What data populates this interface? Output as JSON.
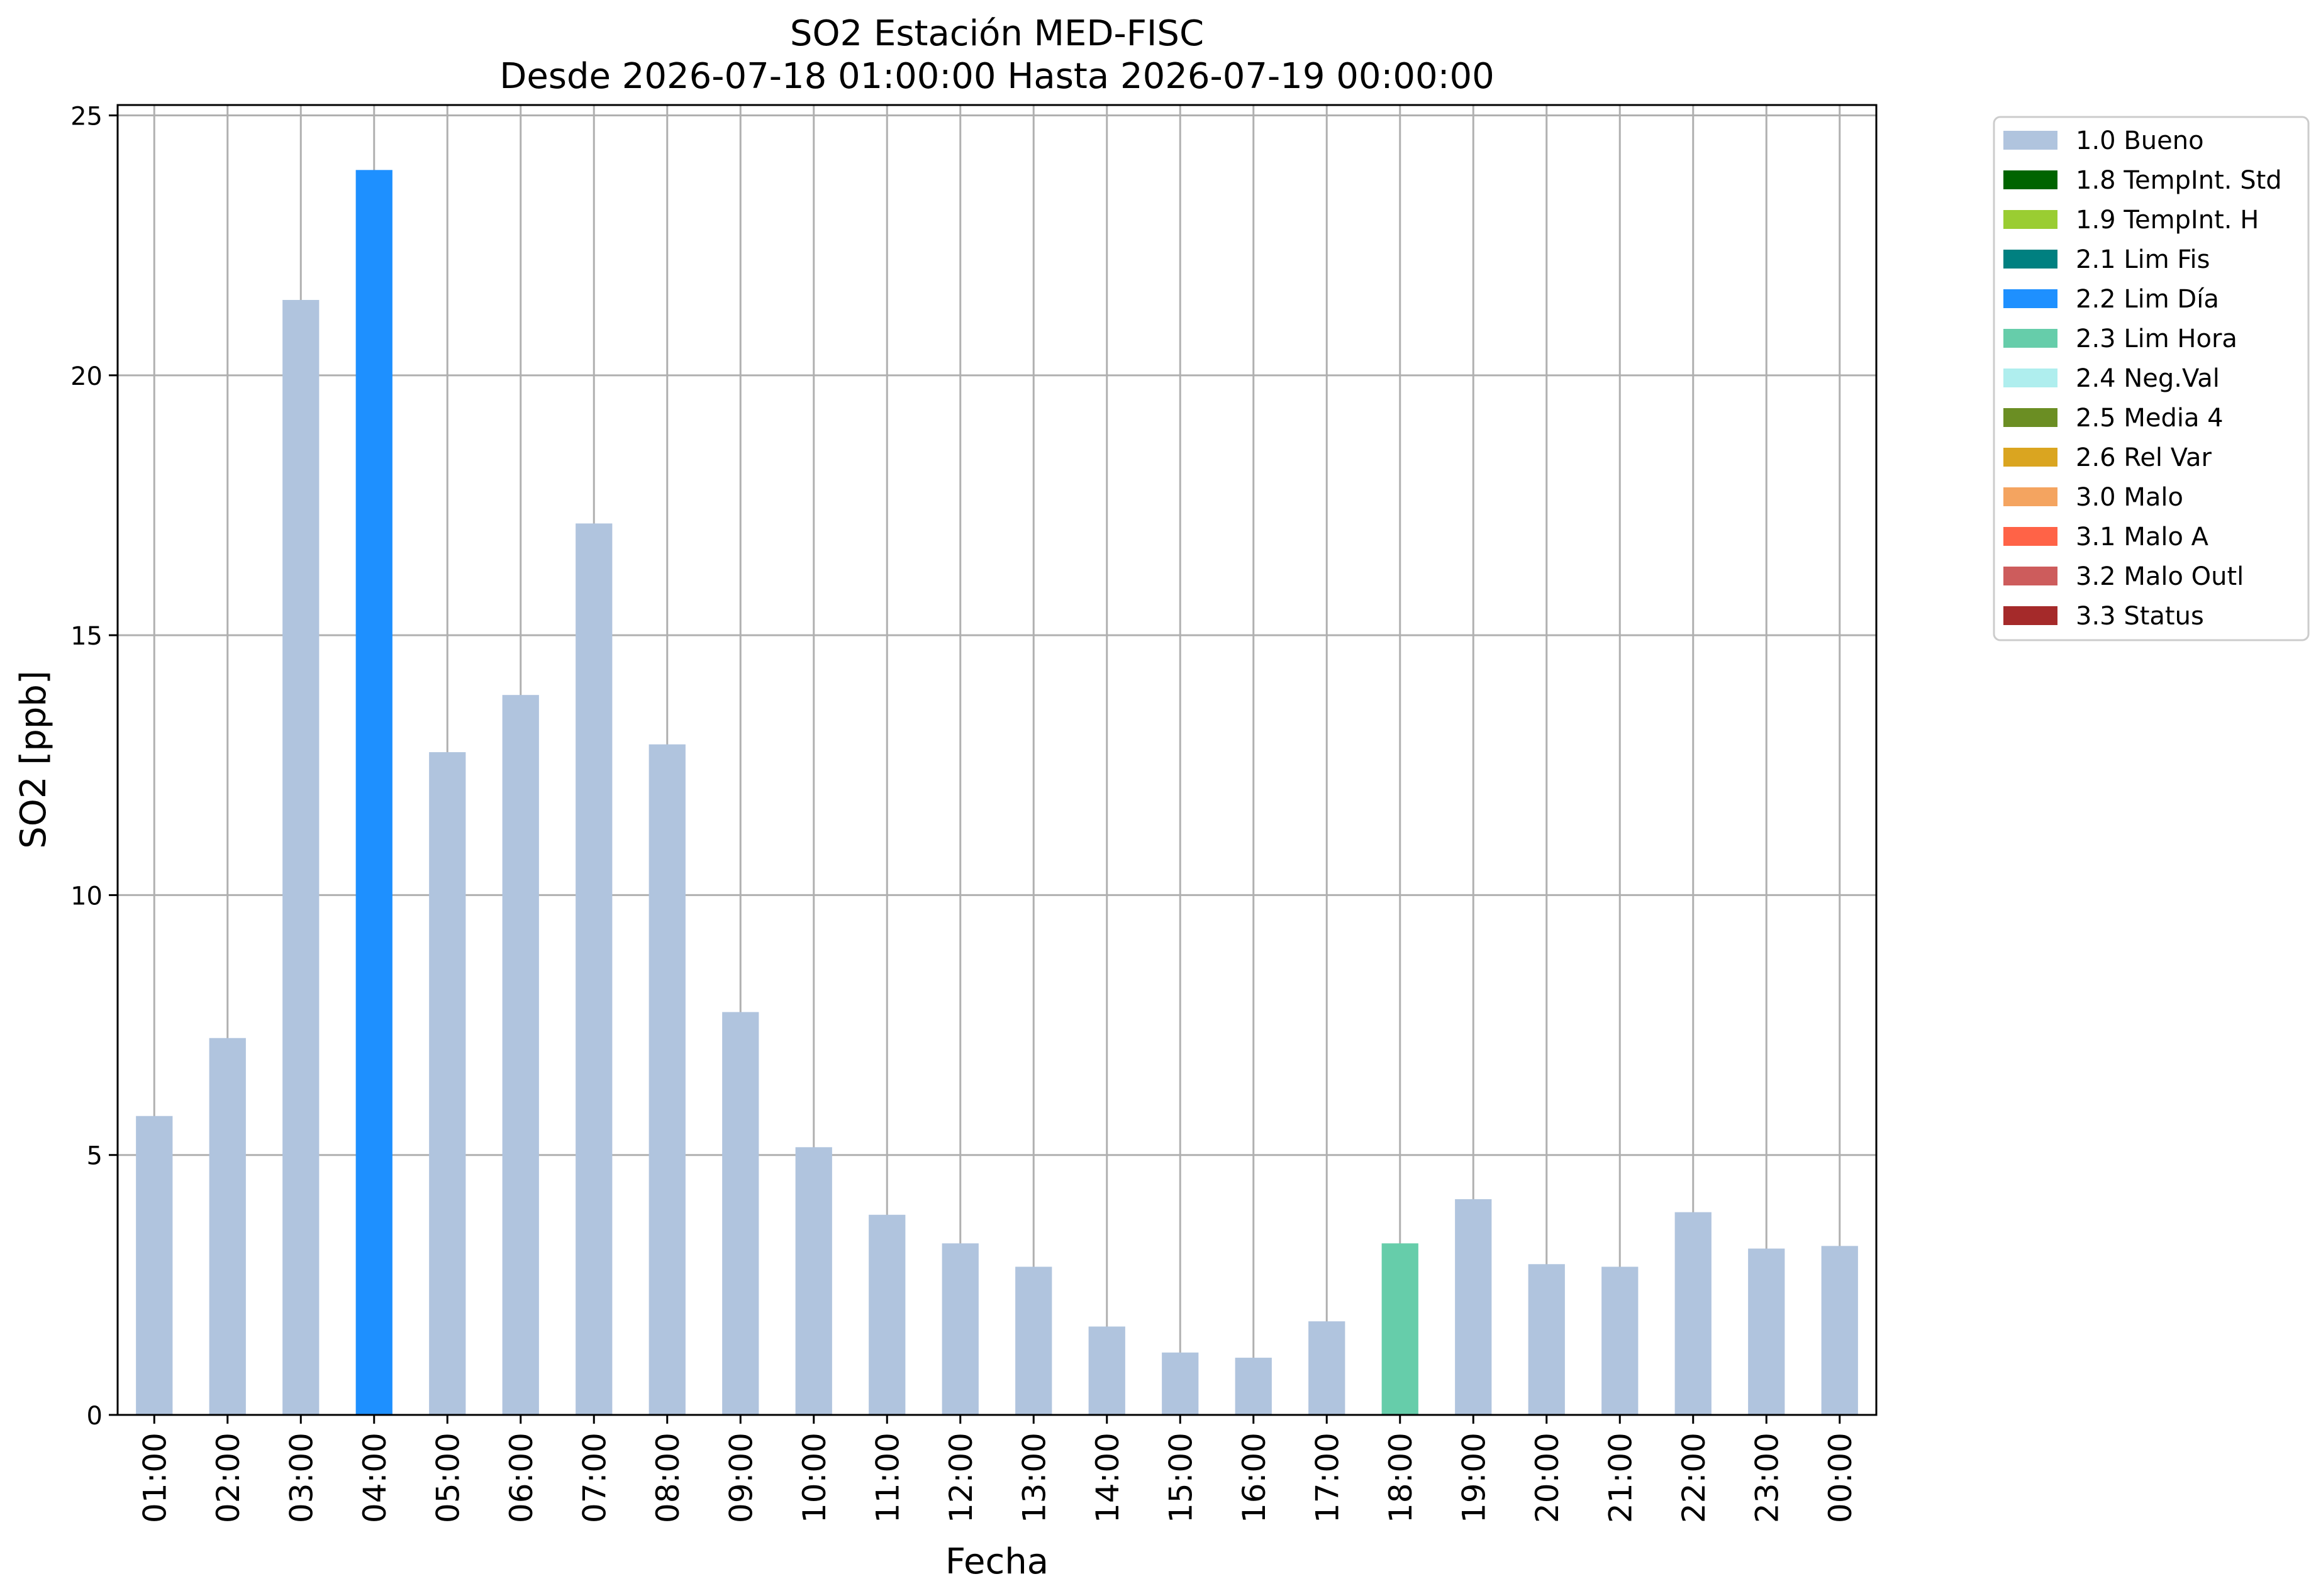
{
  "chart_data": {
    "type": "bar",
    "title": "SO2 Estación MED-FISC",
    "subtitle": "Desde 2026-07-18 01:00:00 Hasta 2026-07-19 00:00:00",
    "xlabel": "Fecha",
    "ylabel": "SO2 [ppb]",
    "ylim": [
      0,
      25.2
    ],
    "yticks": [
      0,
      5,
      10,
      15,
      20,
      25
    ],
    "grid": true,
    "legend_position": "outside-top-right",
    "categories": [
      "01:00",
      "02:00",
      "03:00",
      "04:00",
      "05:00",
      "06:00",
      "07:00",
      "08:00",
      "09:00",
      "10:00",
      "11:00",
      "12:00",
      "13:00",
      "14:00",
      "15:00",
      "16:00",
      "17:00",
      "18:00",
      "19:00",
      "20:00",
      "21:00",
      "22:00",
      "23:00",
      "00:00"
    ],
    "values": [
      5.75,
      7.25,
      21.45,
      23.95,
      12.75,
      13.85,
      17.15,
      12.9,
      7.75,
      5.15,
      3.85,
      3.3,
      2.85,
      1.7,
      1.2,
      1.1,
      1.8,
      3.3,
      4.15,
      2.9,
      2.85,
      3.9,
      3.2,
      3.25
    ],
    "flags": [
      "1.0 Bueno",
      "1.0 Bueno",
      "1.0 Bueno",
      "2.2 Lim Día",
      "1.0 Bueno",
      "1.0 Bueno",
      "1.0 Bueno",
      "1.0 Bueno",
      "1.0 Bueno",
      "1.0 Bueno",
      "1.0 Bueno",
      "1.0 Bueno",
      "1.0 Bueno",
      "1.0 Bueno",
      "1.0 Bueno",
      "1.0 Bueno",
      "1.0 Bueno",
      "2.3 Lim Hora",
      "1.0 Bueno",
      "1.0 Bueno",
      "1.0 Bueno",
      "1.0 Bueno",
      "1.0 Bueno",
      "1.0 Bueno"
    ],
    "legend": [
      {
        "name": "1.0 Bueno",
        "color": "#b0c4de"
      },
      {
        "name": "1.8 TempInt. Std",
        "color": "#006400"
      },
      {
        "name": "1.9 TempInt. H",
        "color": "#9acd32"
      },
      {
        "name": "2.1 Lim Fis",
        "color": "#008080"
      },
      {
        "name": "2.2 Lim Día",
        "color": "#1e90ff"
      },
      {
        "name": "2.3 Lim Hora",
        "color": "#66cdaa"
      },
      {
        "name": "2.4 Neg.Val",
        "color": "#afeeee"
      },
      {
        "name": "2.5 Media 4",
        "color": "#6b8e23"
      },
      {
        "name": "2.6 Rel Var",
        "color": "#daa520"
      },
      {
        "name": "3.0 Malo",
        "color": "#f4a460"
      },
      {
        "name": "3.1 Malo A",
        "color": "#ff6347"
      },
      {
        "name": "3.2 Malo Outl",
        "color": "#cd5c5c"
      },
      {
        "name": "3.3 Status",
        "color": "#a52a2a"
      }
    ]
  }
}
